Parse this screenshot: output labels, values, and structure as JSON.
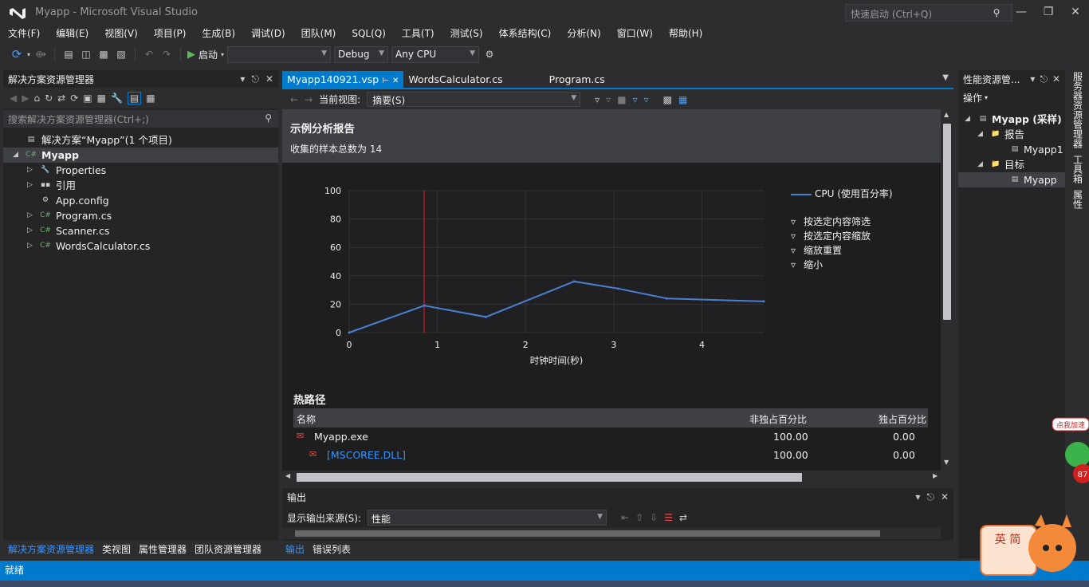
{
  "titlebar": {
    "title": "Myapp - Microsoft Visual Studio",
    "quicklaunch_placeholder": "快速启动 (Ctrl+Q)"
  },
  "menu": [
    "文件(F)",
    "编辑(E)",
    "视图(V)",
    "项目(P)",
    "生成(B)",
    "调试(D)",
    "团队(M)",
    "SQL(Q)",
    "工具(T)",
    "测试(S)",
    "体系结构(C)",
    "分析(N)",
    "窗口(W)",
    "帮助(H)"
  ],
  "toolbar": {
    "start_label": "启动",
    "config": "Debug",
    "platform": "Any CPU",
    "target": ""
  },
  "solution_explorer": {
    "title": "解决方案资源管理器",
    "search_placeholder": "搜索解决方案资源管理器(Ctrl+;)",
    "items": [
      {
        "label": "解决方案“Myapp”(1 个项目)"
      },
      {
        "label": "Myapp"
      },
      {
        "label": "Properties"
      },
      {
        "label": "引用"
      },
      {
        "label": "App.config"
      },
      {
        "label": "Program.cs"
      },
      {
        "label": "Scanner.cs"
      },
      {
        "label": "WordsCalculator.cs"
      }
    ],
    "bottom_tabs": [
      "解决方案资源管理器",
      "类视图",
      "属性管理器",
      "团队资源管理器"
    ]
  },
  "document_tabs": [
    "Myapp140921.vsp",
    "WordsCalculator.cs",
    "Program.cs"
  ],
  "report_toolbar": {
    "view_label": "当前视图:",
    "view_value": "摘要(S)"
  },
  "report": {
    "title": "示例分析报告",
    "subtitle": "收集的样本总数为 14",
    "hotpath_title": "热路径",
    "table_headers": [
      "名称",
      "非独占百分比",
      "独占百分比"
    ],
    "rows": [
      {
        "name": "Myapp.exe",
        "inclusive": "100.00",
        "exclusive": "0.00"
      },
      {
        "name": "[MSCOREE.DLL]",
        "inclusive": "100.00",
        "exclusive": "0.00"
      }
    ],
    "legend_actions": [
      "按选定内容筛选",
      "按选定内容缩放",
      "缩放重置",
      "缩小"
    ]
  },
  "chart_data": {
    "type": "line",
    "xlabel": "时钟时间(秒)",
    "ylabel": "",
    "xlim": [
      0,
      4.7
    ],
    "ylim": [
      0,
      100
    ],
    "xticks": [
      "0",
      "1",
      "2",
      "3",
      "4"
    ],
    "yticks": [
      "0",
      "20",
      "40",
      "60",
      "80",
      "100"
    ],
    "series": [
      {
        "name": "CPU (使用百分率)",
        "color": "#4a7fd0",
        "x": [
          0,
          0.85,
          1.55,
          2.55,
          3.05,
          3.6,
          4.7
        ],
        "y": [
          0,
          19,
          11,
          36,
          31,
          24,
          22
        ]
      }
    ],
    "selection_marker_x": 0.85,
    "grid": true,
    "legend_position": "right"
  },
  "output": {
    "title": "输出",
    "source_label": "显示输出来源(S):",
    "source_value": "性能",
    "tabs": [
      "输出",
      "错误列表"
    ]
  },
  "perf_explorer": {
    "title": "性能资源管...",
    "actions_label": "操作",
    "items": [
      "Myapp (采样)",
      "报告",
      "Myapp1",
      "目标",
      "Myapp"
    ]
  },
  "right_strip": [
    "服务器资源管理器",
    "工具箱",
    "属性"
  ],
  "status": {
    "text": "就绪"
  },
  "overlay": {
    "speed_text": "点我加速",
    "speed_value": "87",
    "ime_text": "英 简"
  },
  "colors": {
    "accent": "#007acc",
    "background": "#2d2d30",
    "panel": "#252526",
    "link": "#3794ff",
    "series": "#4a7fd0",
    "marker": "#c8202a"
  }
}
